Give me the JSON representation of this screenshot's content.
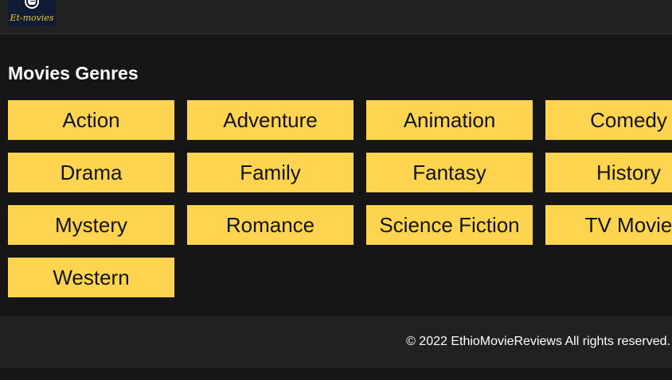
{
  "header": {
    "logo_text": "Et-movies"
  },
  "main": {
    "title": "Movies Genres",
    "genres": [
      "Action",
      "Adventure",
      "Animation",
      "Comedy",
      "Drama",
      "Family",
      "Fantasy",
      "History",
      "Mystery",
      "Romance",
      "Science Fiction",
      "TV Movie",
      "Western"
    ]
  },
  "footer": {
    "copyright": "© 2022 EthioMovieReviews All rights reserved."
  },
  "colors": {
    "page_bg": "#161616",
    "header_bg": "#212121",
    "button_bg": "#ffd451",
    "button_text": "#141414",
    "logo_bg": "#0f1c33",
    "logo_text": "#f2c230"
  }
}
